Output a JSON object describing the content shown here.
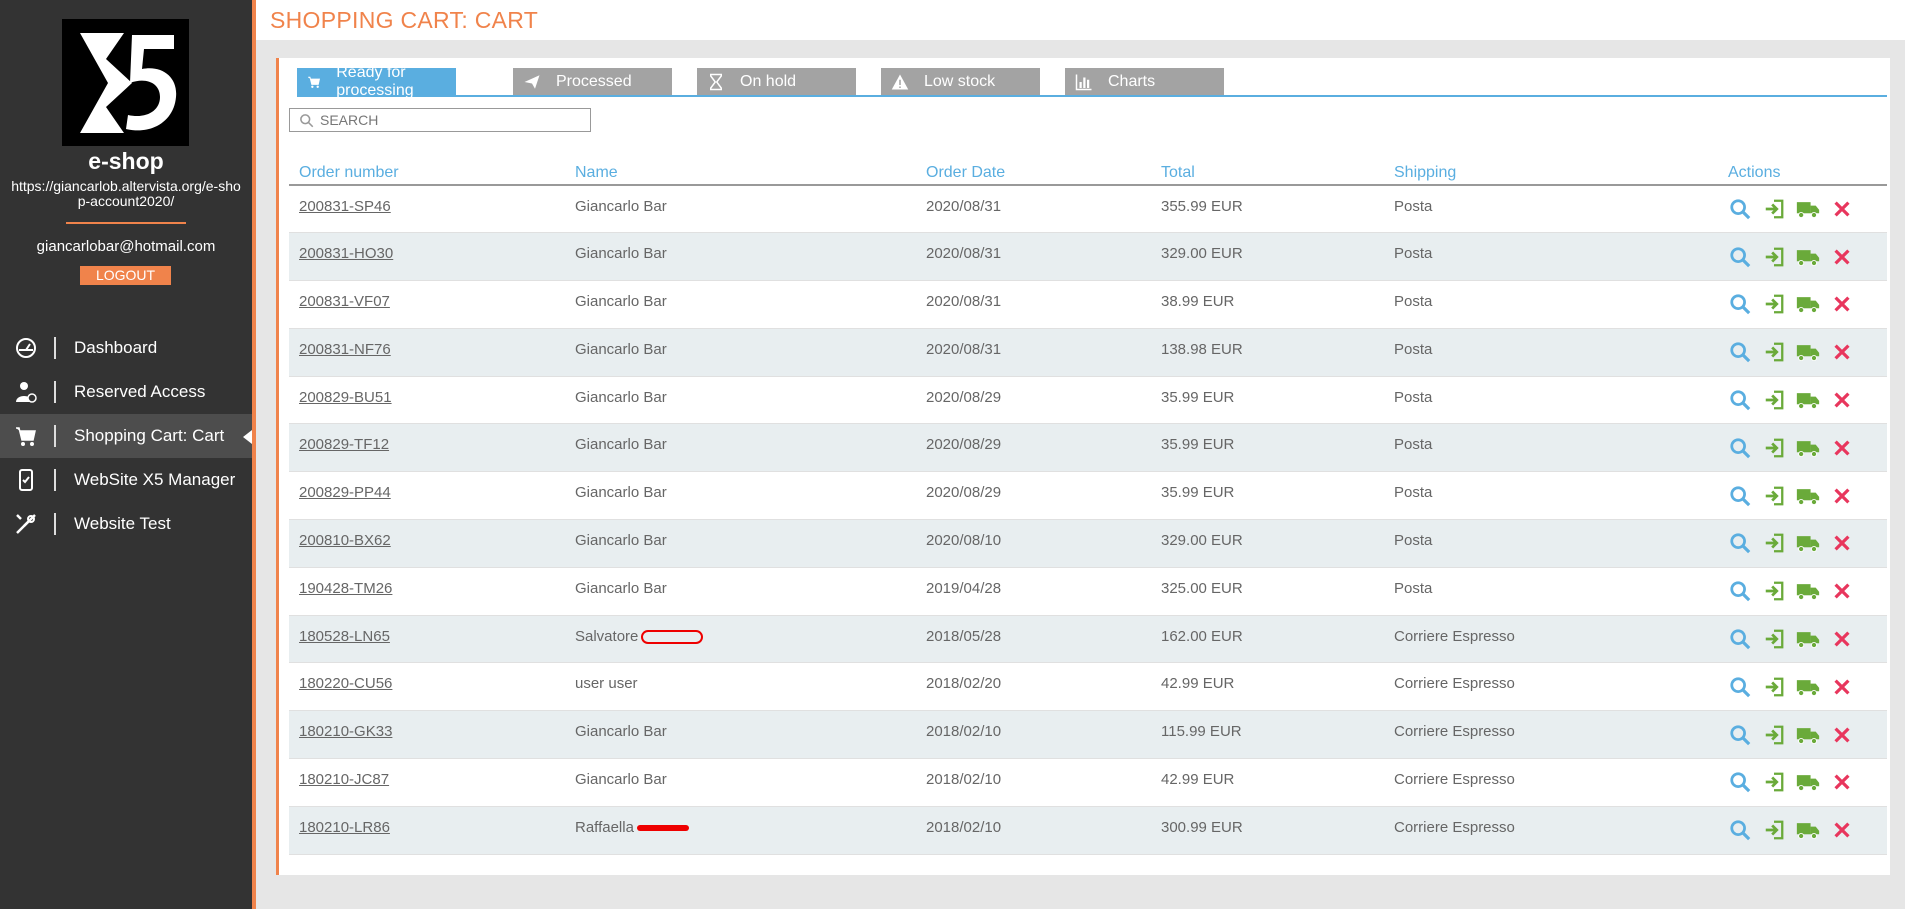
{
  "sidebar": {
    "site_name": "e-shop",
    "site_url": "https://giancarlob.altervista.org/e-shop-account2020/",
    "email": "giancarlobar@hotmail.com",
    "logout_label": "LOGOUT",
    "items": [
      {
        "label": "Dashboard",
        "icon": "gauge-icon"
      },
      {
        "label": "Reserved Access",
        "icon": "user-lock-icon"
      },
      {
        "label": "Shopping Cart: Cart",
        "icon": "cart-icon",
        "active": true
      },
      {
        "label": "WebSite X5 Manager",
        "icon": "mobile-icon"
      },
      {
        "label": "Website Test",
        "icon": "tools-icon"
      }
    ]
  },
  "header": {
    "title": "SHOPPING CART: CART"
  },
  "tabs": [
    {
      "label": "Ready for processing",
      "icon": "cart-icon",
      "active": true
    },
    {
      "label": "Processed",
      "icon": "send-icon"
    },
    {
      "label": "On hold",
      "icon": "hourglass-icon"
    },
    {
      "label": "Low stock",
      "icon": "warning-icon"
    },
    {
      "label": "Charts",
      "icon": "chart-icon"
    }
  ],
  "search": {
    "placeholder": "SEARCH"
  },
  "table": {
    "columns": [
      "Order number",
      "Name",
      "Order Date",
      "Total",
      "Shipping",
      "Actions"
    ],
    "rows": [
      {
        "order": "200831-SP46",
        "name": "Giancarlo Bar",
        "date": "2020/08/31",
        "total": "355.99 EUR",
        "shipping": "Posta"
      },
      {
        "order": "200831-HO30",
        "name": "Giancarlo Bar",
        "date": "2020/08/31",
        "total": "329.00 EUR",
        "shipping": "Posta"
      },
      {
        "order": "200831-VF07",
        "name": "Giancarlo Bar",
        "date": "2020/08/31",
        "total": "38.99 EUR",
        "shipping": "Posta"
      },
      {
        "order": "200831-NF76",
        "name": "Giancarlo Bar",
        "date": "2020/08/31",
        "total": "138.98 EUR",
        "shipping": "Posta"
      },
      {
        "order": "200829-BU51",
        "name": "Giancarlo Bar",
        "date": "2020/08/29",
        "total": "35.99 EUR",
        "shipping": "Posta"
      },
      {
        "order": "200829-TF12",
        "name": "Giancarlo Bar",
        "date": "2020/08/29",
        "total": "35.99 EUR",
        "shipping": "Posta"
      },
      {
        "order": "200829-PP44",
        "name": "Giancarlo Bar",
        "date": "2020/08/29",
        "total": "35.99 EUR",
        "shipping": "Posta"
      },
      {
        "order": "200810-BX62",
        "name": "Giancarlo Bar",
        "date": "2020/08/10",
        "total": "329.00 EUR",
        "shipping": "Posta"
      },
      {
        "order": "190428-TM26",
        "name": "Giancarlo Bar",
        "date": "2019/04/28",
        "total": "325.00 EUR",
        "shipping": "Posta"
      },
      {
        "order": "180528-LN65",
        "name": "Salvatore",
        "redacted": 1,
        "date": "2018/05/28",
        "total": "162.00 EUR",
        "shipping": "Corriere Espresso"
      },
      {
        "order": "180220-CU56",
        "name": "user user",
        "date": "2018/02/20",
        "total": "42.99 EUR",
        "shipping": "Corriere Espresso"
      },
      {
        "order": "180210-GK33",
        "name": "Giancarlo Bar",
        "date": "2018/02/10",
        "total": "115.99 EUR",
        "shipping": "Corriere Espresso"
      },
      {
        "order": "180210-JC87",
        "name": "Giancarlo Bar",
        "date": "2018/02/10",
        "total": "42.99 EUR",
        "shipping": "Corriere Espresso"
      },
      {
        "order": "180210-LR86",
        "name": "Raffaella",
        "redacted": 2,
        "date": "2018/02/10",
        "total": "300.99 EUR",
        "shipping": "Corriere Espresso"
      }
    ]
  },
  "colors": {
    "accent": "#f0834b",
    "blue": "#5aaee0",
    "green": "#6aaa3a",
    "red": "#e8365d"
  }
}
